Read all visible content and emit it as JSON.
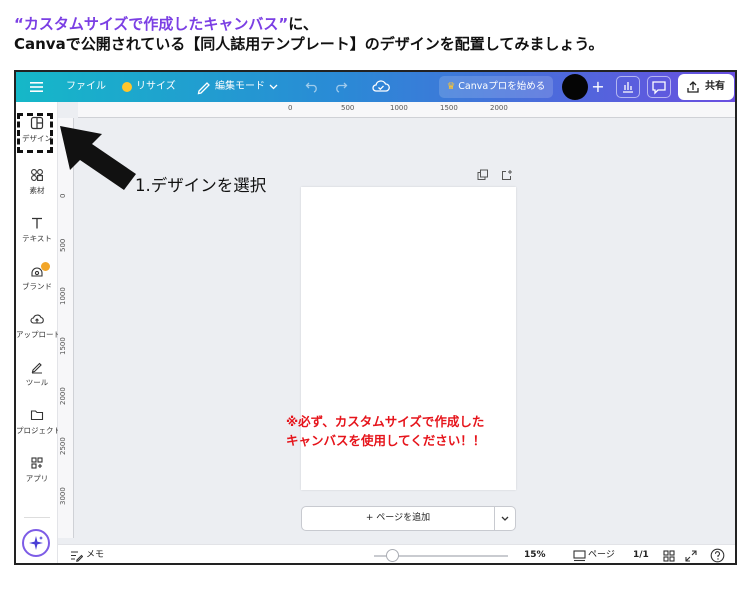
{
  "instruction": {
    "line1_highlight": "“カスタムサイズで作成したキャンバス”",
    "line1_rest": "に、",
    "line2": "Canvaで公開されている【同人誌用テンプレート】のデザインを配置してみましょう。"
  },
  "topbar": {
    "menu_icon": "hamburger-icon",
    "file_label": "ファイル",
    "resize_label": "リサイズ",
    "edit_mode_label": "編集モード",
    "upgrade_label": "Canvaプロを始める",
    "share_label": "共有",
    "colors": {
      "gradient_start": "#15b8c8",
      "gradient_end": "#6a4fe0",
      "crown": "#ffc62b"
    }
  },
  "sidebar": {
    "items": [
      {
        "label": "デザイン",
        "icon": "design-layout-icon"
      },
      {
        "label": "素材",
        "icon": "elements-shapes-icon"
      },
      {
        "label": "テキスト",
        "icon": "text-t-icon"
      },
      {
        "label": "ブランド",
        "icon": "brand-icon"
      },
      {
        "label": "アップロード",
        "icon": "upload-cloud-icon"
      },
      {
        "label": "ツール",
        "icon": "pen-tool-icon"
      },
      {
        "label": "プロジェクト",
        "icon": "folder-icon"
      },
      {
        "label": "アプリ",
        "icon": "apps-grid-icon"
      }
    ],
    "magic_icon": "magic-sparkle-icon"
  },
  "rulers": {
    "top": [
      "0",
      "500",
      "1000",
      "1500",
      "2000"
    ],
    "left": [
      "0",
      "500",
      "1000",
      "1500",
      "2000",
      "2500",
      "3000"
    ]
  },
  "canvas": {
    "note_line1": "※必ず、カスタムサイズで作成した",
    "note_line2": "キャンバスを使用してください！！",
    "note_color": "#e6141b",
    "add_page_label": "+ ページを追加"
  },
  "bottombar": {
    "notes_label": "メモ",
    "zoom": "15%",
    "zoom_fraction": 0.1,
    "pages_label": "ページ",
    "page_count": "1/1"
  },
  "annotation": {
    "step_label": "1.デザインを選択"
  }
}
